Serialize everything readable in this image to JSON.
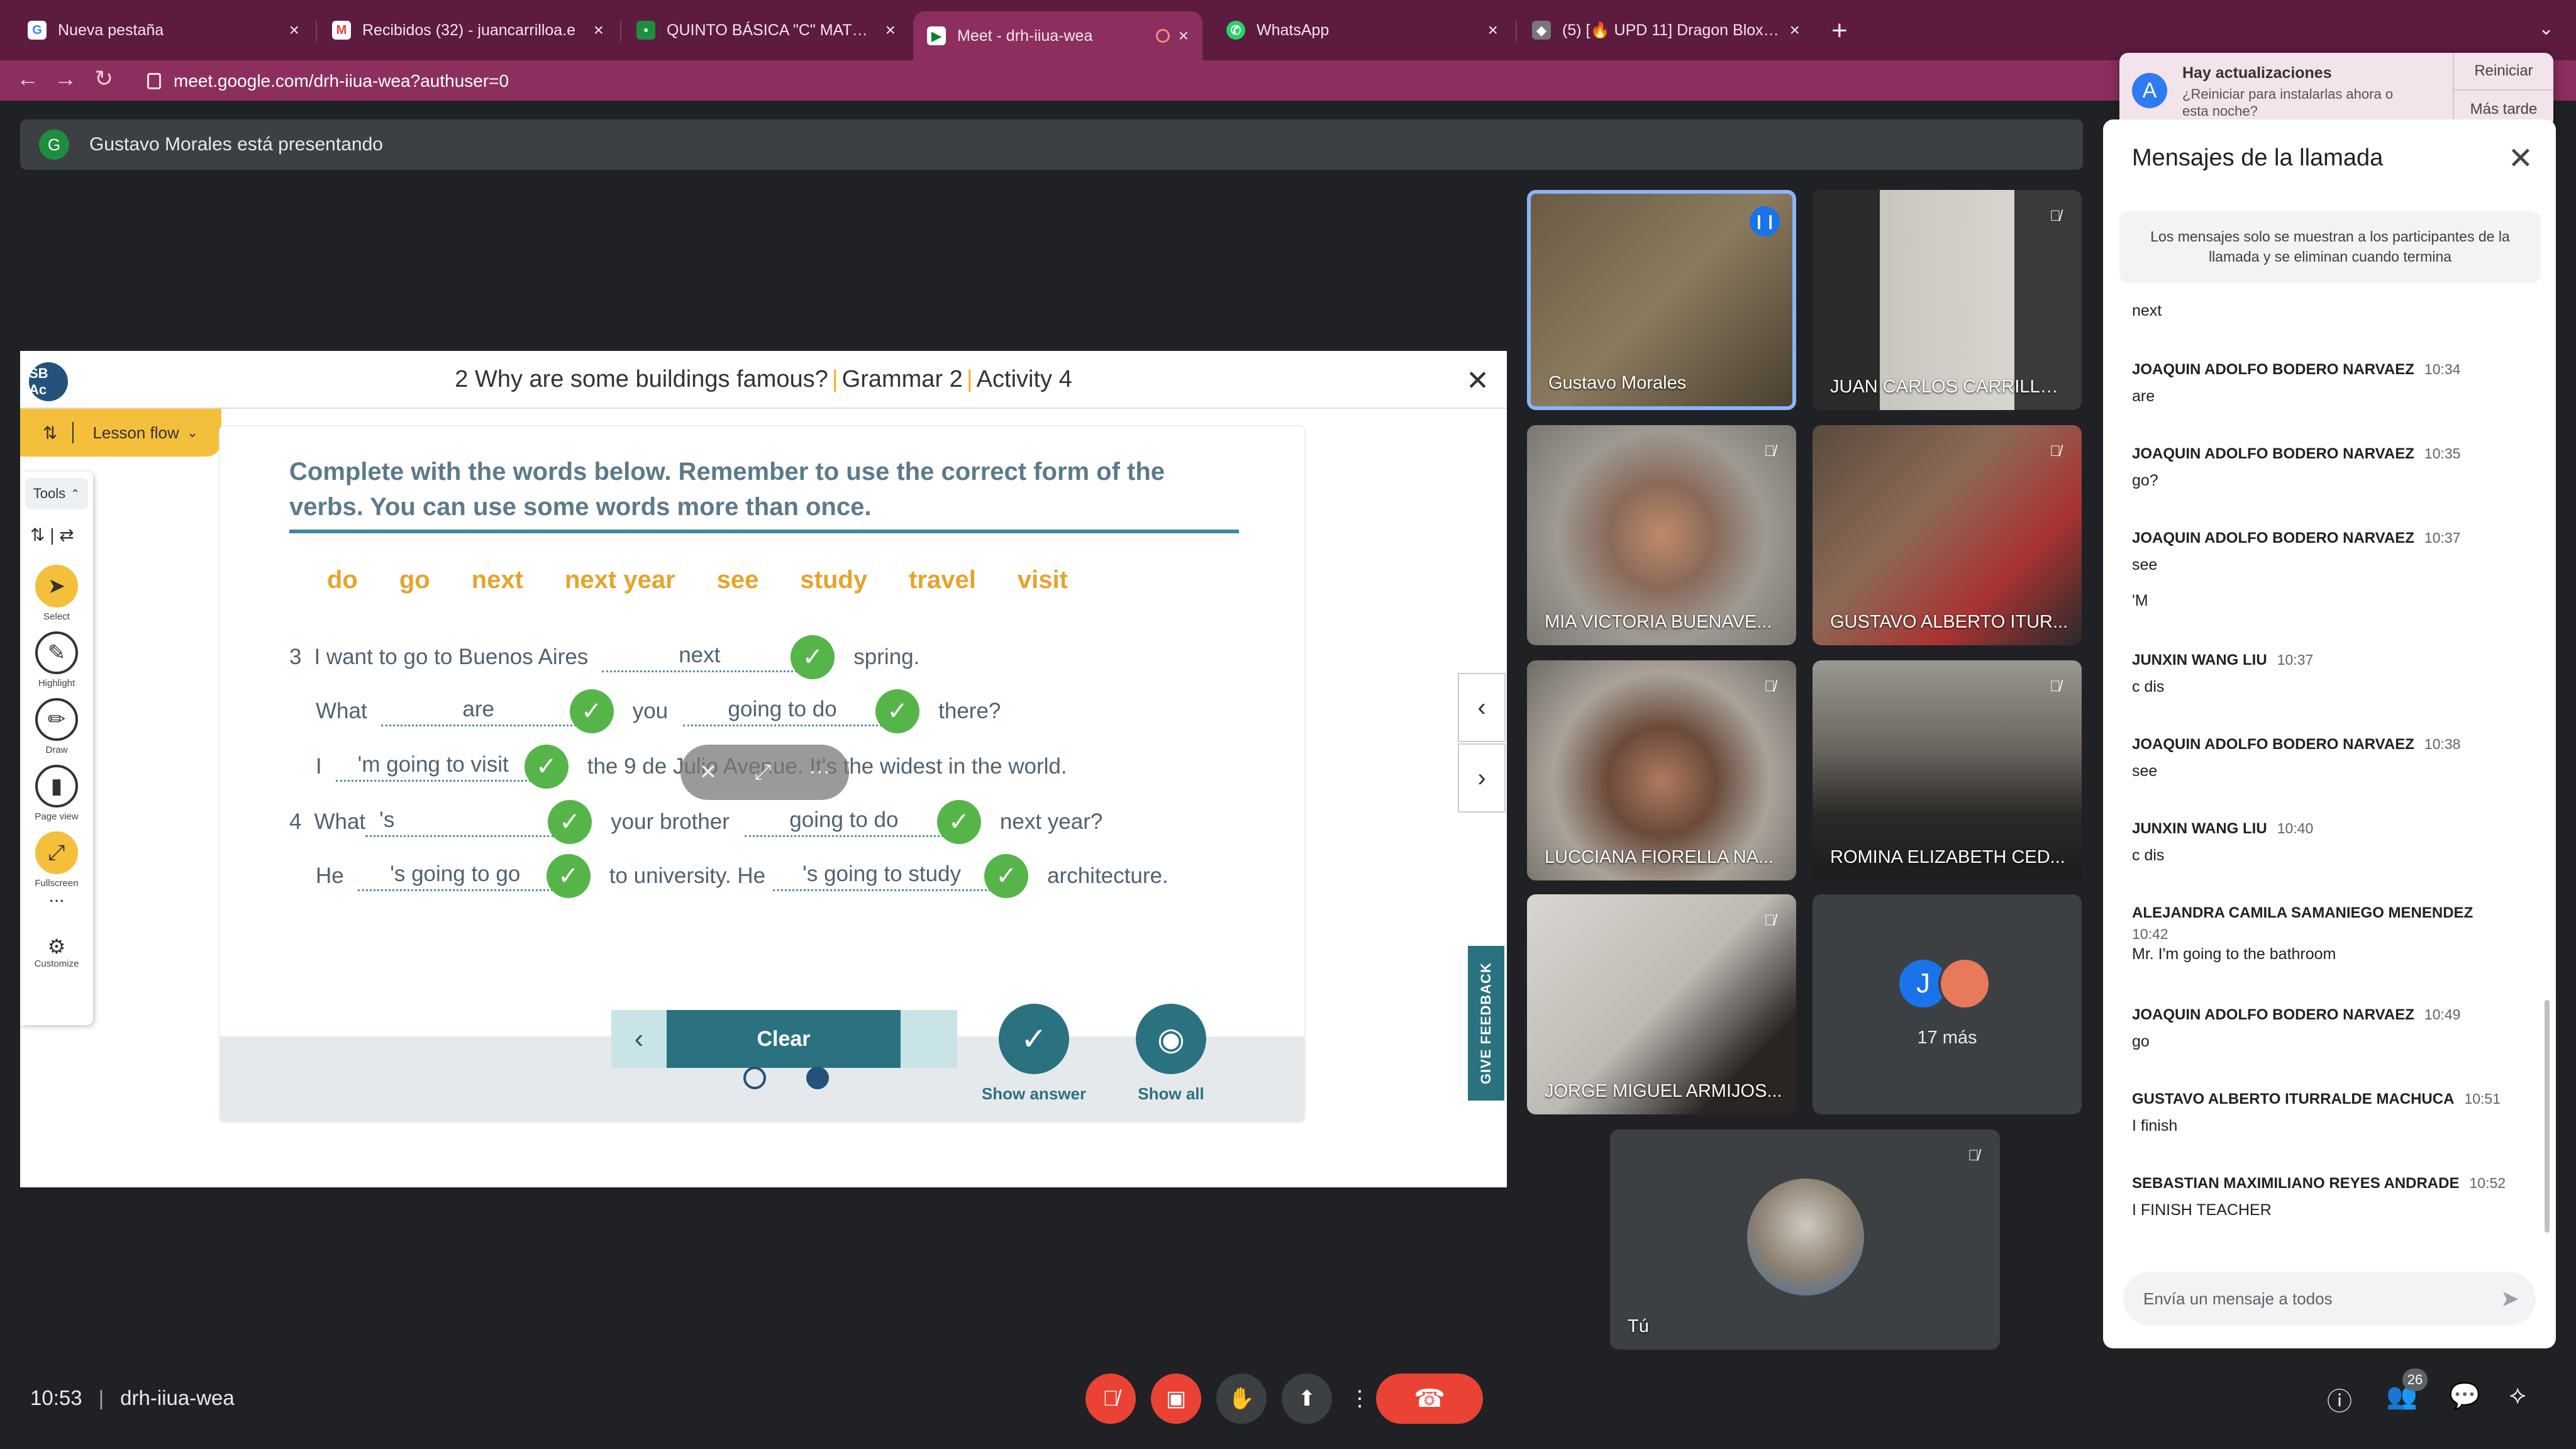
{
  "browser": {
    "tabs": [
      {
        "label": "Nueva pestaña",
        "icon": "google-icon",
        "active": false
      },
      {
        "label": "Recibidos (32) - juancarrilloa.e",
        "icon": "gmail-icon",
        "active": false
      },
      {
        "label": "QUINTO BÁSICA \"C\" MATUTIN",
        "icon": "classroom-icon",
        "active": false
      },
      {
        "label": "Meet - drh-iiua-wea",
        "icon": "meet-icon",
        "active": true
      },
      {
        "label": "WhatsApp",
        "icon": "whatsapp-icon",
        "active": false
      },
      {
        "label": "(5) [🔥 UPD 11] Dragon Blox - R",
        "icon": "roblox-icon",
        "active": false
      }
    ],
    "url": "meet.google.com/drh-iiua-wea?authuser=0"
  },
  "update_popup": {
    "title": "Hay actualizaciones",
    "body": "¿Reiniciar para instalarlas ahora o esta noche?",
    "restart_label": "Reiniciar",
    "later_label": "Más tarde"
  },
  "banner": {
    "avatar_letter": "G",
    "text": "Gustavo Morales está presentando"
  },
  "lesson": {
    "logo_text": "SB Ac",
    "title_part1": "2 Why are some buildings famous?",
    "title_part2": "Grammar 2",
    "title_part3": "Activity 4",
    "lesson_flow_label": "Lesson flow",
    "tools_label": "Tools",
    "tools": [
      {
        "label": "Select",
        "icon": "cursor-icon"
      },
      {
        "label": "Highlight",
        "icon": "highlighter-icon"
      },
      {
        "label": "Draw",
        "icon": "pencil-icon"
      },
      {
        "label": "Page view",
        "icon": "page-icon"
      },
      {
        "label": "Fullscreen",
        "icon": "fullscreen-icon"
      }
    ],
    "more_label": "...",
    "customize_label": "Customize",
    "instructions": "Complete with the words below. Remember to use the correct form of the verbs. You can use some words more than once.",
    "word_bank": [
      "do",
      "go",
      "next",
      "next year",
      "see",
      "study",
      "travel",
      "visit"
    ],
    "exercise": {
      "q3_num": "3",
      "l1": {
        "a": "I want to go to Buenos Aires",
        "blank": "next",
        "b": "spring."
      },
      "l2": {
        "a": "What",
        "blank1": "are",
        "b": "you",
        "blank2": "going to do",
        "c": "there?"
      },
      "l3": {
        "a": "I",
        "blank": "'m going to visit",
        "b": "the 9 de Julio Avenue. It's the widest in the world."
      },
      "q4_num": "4",
      "l4": {
        "a": "What",
        "blank1": "'s",
        "b": "your brother",
        "blank2": "going to do",
        "c": "next year?"
      },
      "l5": {
        "a": "He",
        "blank1": "'s going to go",
        "b": "to university. He",
        "blank2": "'s going to study",
        "c": "architecture."
      }
    },
    "clear_label": "Clear",
    "show_answer_label": "Show answer",
    "show_all_label": "Show all",
    "give_feedback_label": "GIVE FEEDBACK",
    "pages": {
      "current": 2,
      "total": 2
    }
  },
  "participants": [
    {
      "name": "Gustavo Morales",
      "muted": false,
      "speaking": true
    },
    {
      "name": "JUAN CARLOS CARRILLO...",
      "muted": true
    },
    {
      "name": "MIA VICTORIA BUENAVE...",
      "muted": true
    },
    {
      "name": "GUSTAVO ALBERTO ITUR...",
      "muted": true
    },
    {
      "name": "LUCCIANA FIORELLA NA...",
      "muted": true
    },
    {
      "name": "ROMINA ELIZABETH CED...",
      "muted": true
    },
    {
      "name": "JORGE MIGUEL ARMIJOS...",
      "muted": true
    }
  ],
  "more_tile": {
    "avatar_letter": "J",
    "label": "17 más"
  },
  "self_tile": {
    "name": "Tú",
    "muted": true
  },
  "chat": {
    "title": "Mensajes de la llamada",
    "notice": "Los mensajes solo se muestran a los participantes de la llamada y se eliminan cuando termina",
    "top_text": "next",
    "messages": [
      {
        "sender": "JOAQUIN ADOLFO BODERO NARVAEZ",
        "time": "10:34",
        "texts": [
          "are"
        ]
      },
      {
        "sender": "JOAQUIN ADOLFO BODERO NARVAEZ",
        "time": "10:35",
        "texts": [
          "go?"
        ]
      },
      {
        "sender": "JOAQUIN ADOLFO BODERO NARVAEZ",
        "time": "10:37",
        "texts": [
          "see",
          "'M"
        ]
      },
      {
        "sender": "JUNXIN WANG LIU",
        "time": "10:37",
        "texts": [
          "c dis"
        ]
      },
      {
        "sender": "JOAQUIN ADOLFO BODERO NARVAEZ",
        "time": "10:38",
        "texts": [
          "see"
        ]
      },
      {
        "sender": "JUNXIN WANG LIU",
        "time": "10:40",
        "texts": [
          "c dis"
        ]
      },
      {
        "sender": "ALEJANDRA CAMILA SAMANIEGO MENENDEZ",
        "time": "10:42",
        "texts": [
          "Mr.  I'm going to the bathroom"
        ]
      },
      {
        "sender": "JOAQUIN ADOLFO BODERO NARVAEZ",
        "time": "10:49",
        "texts": [
          "go"
        ]
      },
      {
        "sender": "GUSTAVO ALBERTO ITURRALDE MACHUCA",
        "time": "10:51",
        "texts": [
          "I finish"
        ]
      },
      {
        "sender": "SEBASTIAN MAXIMILIANO REYES ANDRADE",
        "time": "10:52",
        "texts": [
          "I FINISH TEACHER"
        ]
      }
    ],
    "input_placeholder": "Envía un mensaje a todos"
  },
  "bottom": {
    "time": "10:53",
    "meeting_code": "drh-iiua-wea",
    "people_count": "26"
  },
  "colors": {
    "tab_bar": "#5c1b3f",
    "address_bar": "#8c2f5e",
    "meet_bg": "#202124",
    "danger_red": "#ea4335",
    "check_green": "#55b549",
    "word_bank_orange": "#e6a42c",
    "lesson_teal": "#2b7280"
  }
}
